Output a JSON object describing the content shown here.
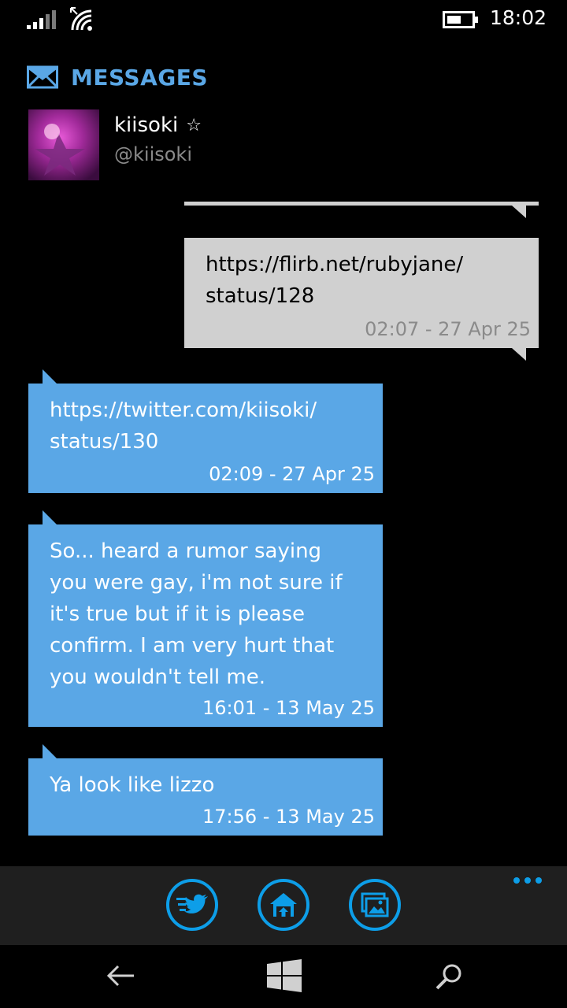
{
  "status_bar": {
    "time": "18:02",
    "icons": [
      "signal-icon",
      "wifi-icon",
      "battery-icon"
    ]
  },
  "app": {
    "title": "MESSAGES",
    "accent_color": "#5aa7e6",
    "icon": "mail-icon"
  },
  "profile": {
    "name": "kiisoki",
    "star": "☆",
    "handle": "@kiisoki"
  },
  "messages": [
    {
      "direction": "sent",
      "text": "https://flirb.net/rubyjane/\nstatus/128",
      "timestamp": "02:07 - 27 Apr 25"
    },
    {
      "direction": "received",
      "text": "https://twitter.com/kiisoki/\nstatus/130",
      "timestamp": "02:09 - 27 Apr 25"
    },
    {
      "direction": "received",
      "text": "So... heard a rumor saying\nyou were gay, i'm not sure if\nit's true but if it is please\nconfirm. I am very hurt that\nyou wouldn't tell me.",
      "timestamp": "16:01 - 13 May 25"
    },
    {
      "direction": "received",
      "text": "Ya look like lizzo",
      "timestamp": "17:56 - 13 May 25"
    }
  ],
  "app_bar": {
    "buttons": [
      "tweet-icon",
      "home-icon",
      "gallery-icon"
    ],
    "more": "more-icon"
  },
  "nav_bar": {
    "buttons": [
      "back-icon",
      "windows-start-icon",
      "search-icon"
    ]
  },
  "colors": {
    "received_bubble": "#5aa7e6",
    "sent_bubble": "#d0d0d0",
    "appbar_accent": "#0d9ee8"
  }
}
